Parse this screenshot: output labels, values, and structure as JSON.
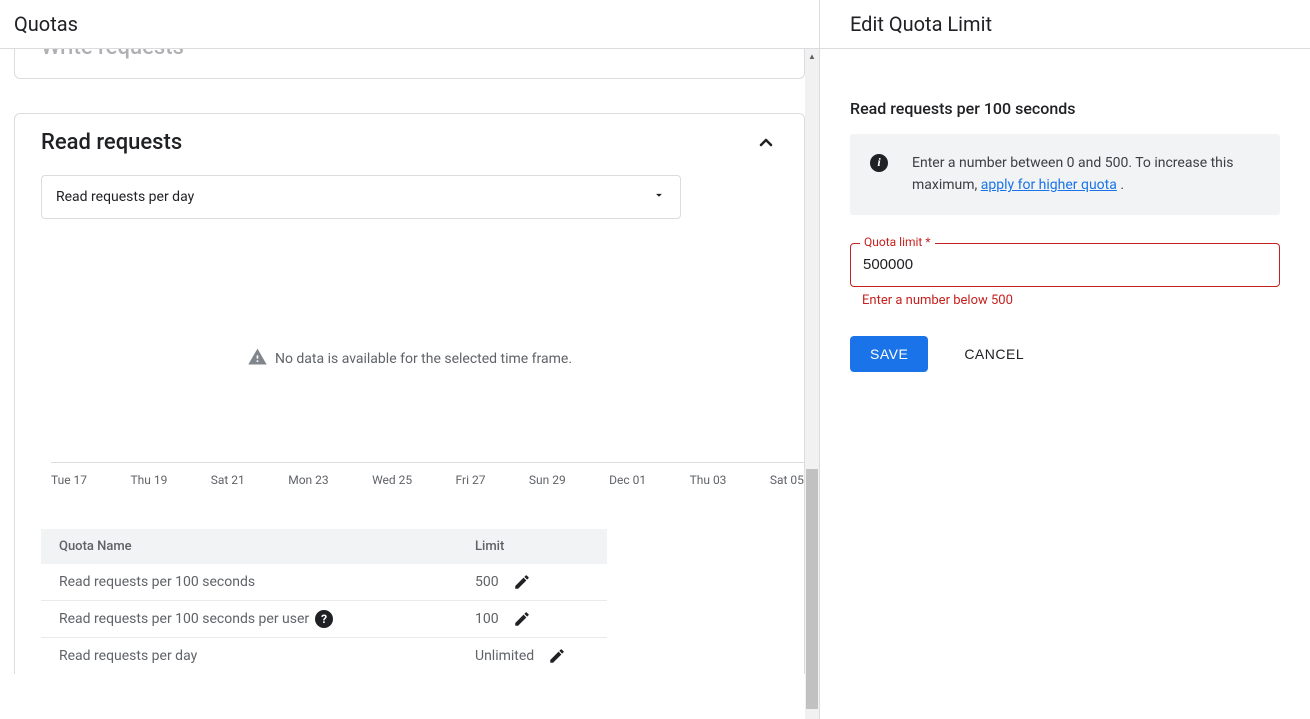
{
  "left": {
    "title": "Quotas",
    "write_card_title": "Write requests",
    "read_card": {
      "title": "Read requests",
      "select_label": "Read requests per day",
      "no_data_text": "No data is available for the selected time frame."
    },
    "table": {
      "col_name": "Quota Name",
      "col_limit": "Limit",
      "rows": [
        {
          "name": "Read requests per 100 seconds",
          "limit": "500",
          "help": false,
          "edit": true
        },
        {
          "name": "Read requests per 100 seconds per user",
          "limit": "100",
          "help": true,
          "edit": true
        },
        {
          "name": "Read requests per day",
          "limit": "Unlimited",
          "help": false,
          "edit": true
        }
      ]
    }
  },
  "right": {
    "title": "Edit Quota Limit",
    "panel_title": "Read requests per 100 seconds",
    "info_text_prefix": "Enter a number between 0 and 500. To increase this maximum, ",
    "info_link_text": "apply for higher quota",
    "info_text_suffix": " .",
    "field_label": "Quota limit *",
    "field_value": "500000",
    "field_error": "Enter a number below 500",
    "save_label": "SAVE",
    "cancel_label": "CANCEL"
  },
  "chart_data": {
    "type": "line",
    "title": "Read requests per day",
    "categories": [
      "Tue 17",
      "Thu 19",
      "Sat 21",
      "Mon 23",
      "Wed 25",
      "Fri 27",
      "Sun 29",
      "Dec 01",
      "Thu 03",
      "Sat 05"
    ],
    "series": [],
    "note": "No data is available for the selected time frame.",
    "xlabel": "",
    "ylabel": ""
  }
}
